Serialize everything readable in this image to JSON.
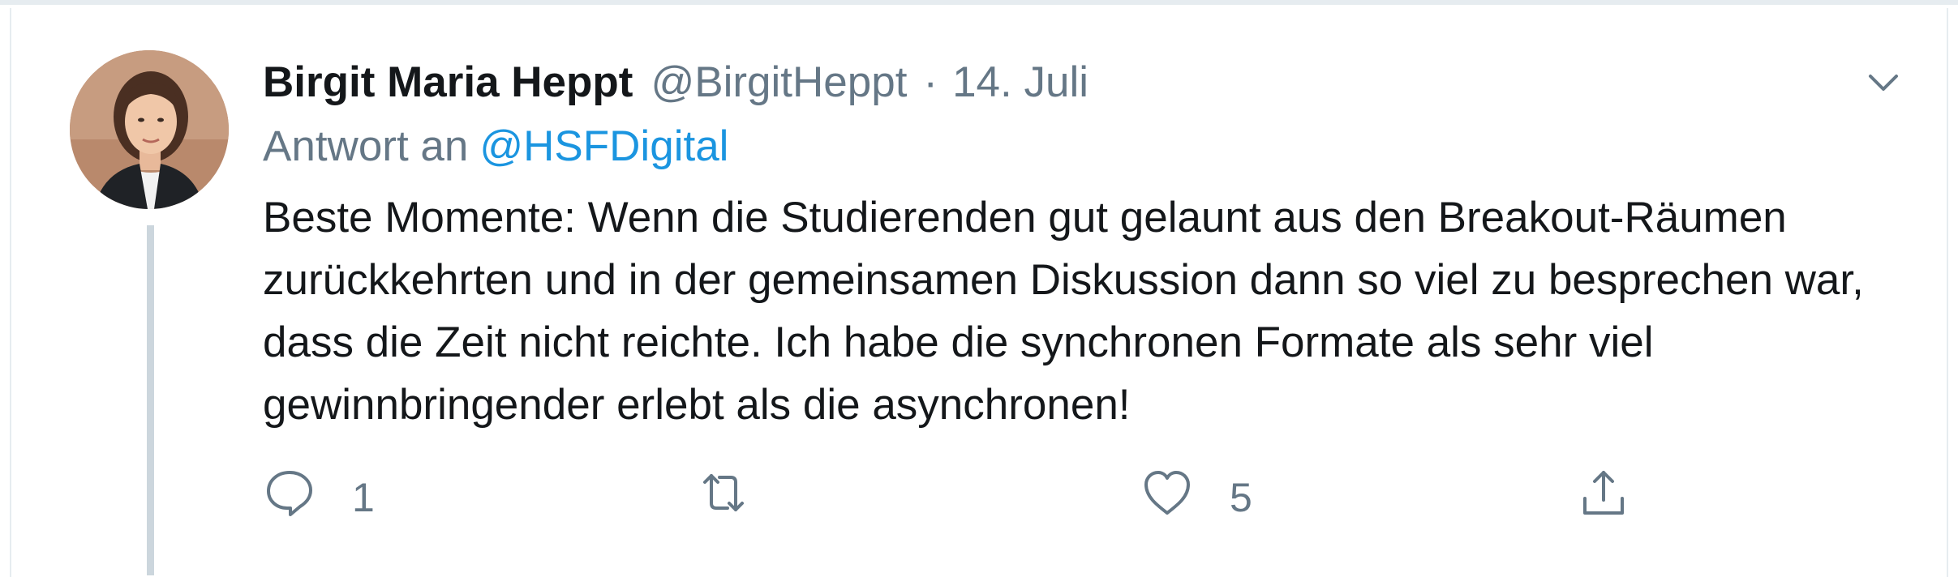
{
  "tweet": {
    "author_name": "Birgit Maria Heppt",
    "author_handle": "@BirgitHeppt",
    "separator": "·",
    "date": "14. Juli",
    "reply_prefix": "Antwort an",
    "reply_mention": "@HSFDigital",
    "text": "Beste Momente: Wenn die Studierenden gut gelaunt aus den Breakout-Räumen zurückkehrten und in der gemeinsamen Diskussion dann so viel zu besprechen war, dass die Zeit nicht reichte. Ich habe die synchronen Formate als sehr viel gewinnbringender erlebt als die asynchronen!"
  },
  "actions": {
    "reply_count": "1",
    "like_count": "5"
  },
  "icons": {
    "reply": "comment-icon",
    "retweet": "retweet-icon",
    "like": "heart-icon",
    "share": "share-icon",
    "menu": "chevron-down-icon"
  },
  "colors": {
    "text": "#14171a",
    "secondary": "#657786",
    "link": "#1b95e0",
    "thread_line": "#ccd6dd"
  }
}
